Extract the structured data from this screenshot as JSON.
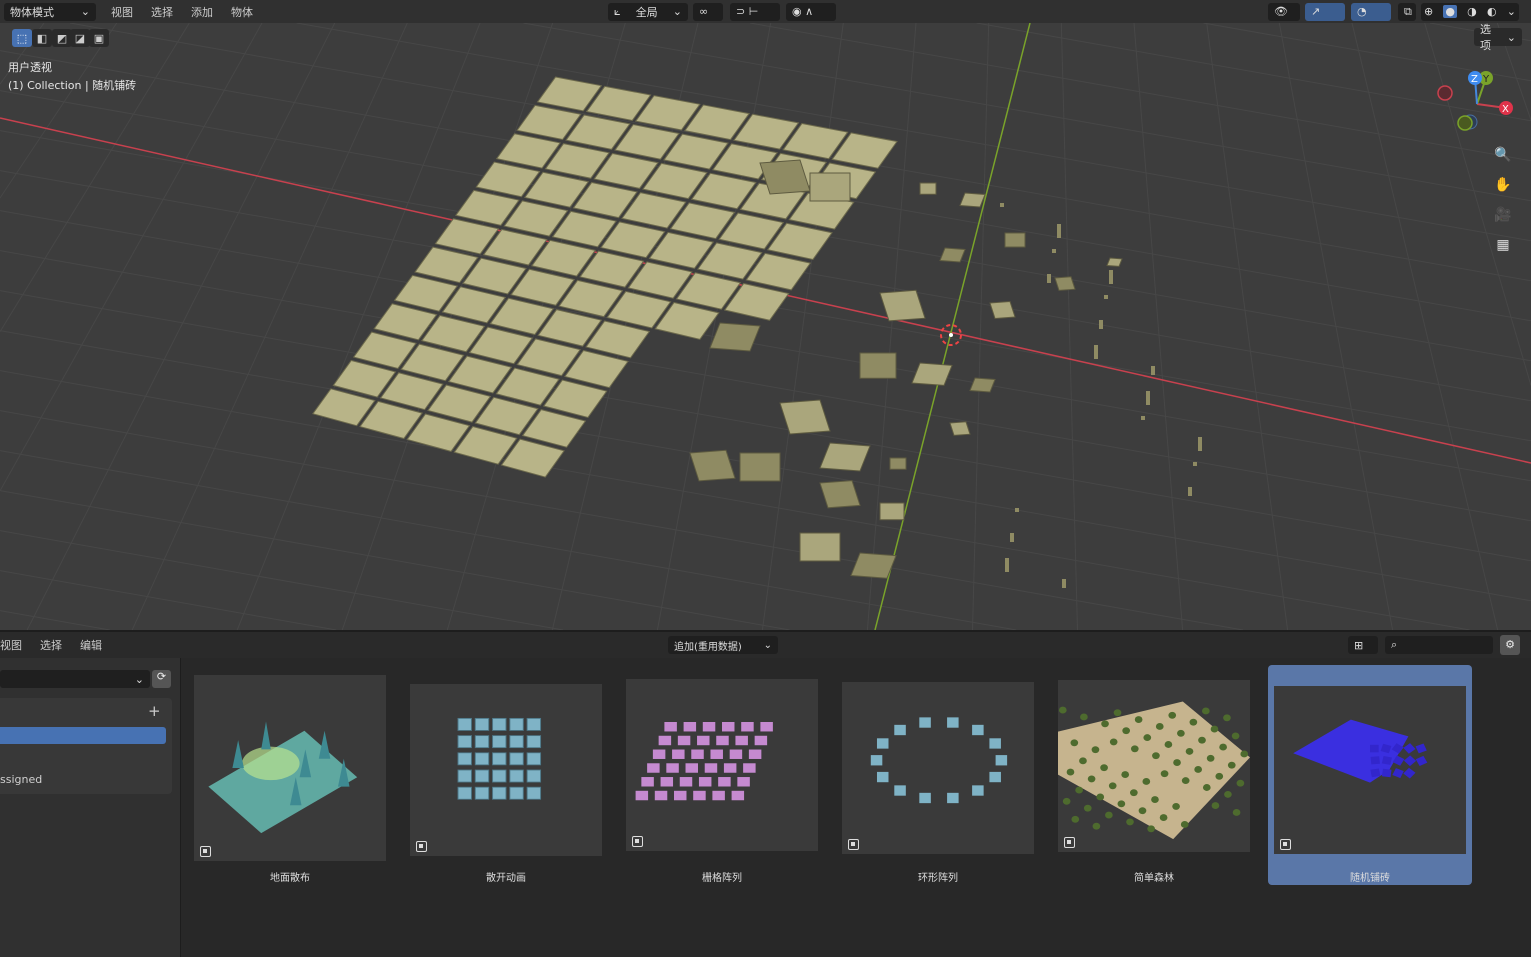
{
  "header": {
    "mode": "物体模式",
    "menus": [
      "视图",
      "选择",
      "添加",
      "物体"
    ],
    "transform_orientation": "全局"
  },
  "viewport": {
    "view_name": "用户透视",
    "collection_info": "(1) Collection | 随机铺砖",
    "options_label": "选项",
    "gizmo_axes": [
      "X",
      "Y",
      "Z"
    ]
  },
  "asset_browser": {
    "menus": [
      "视图",
      "选择",
      "编辑"
    ],
    "import_method": "追加(重用数据)",
    "search_placeholder": "",
    "left_items": [
      "",
      "",
      "ssigned"
    ],
    "assets": [
      {
        "label": "地面散布"
      },
      {
        "label": "散开动画"
      },
      {
        "label": "栅格阵列"
      },
      {
        "label": "环形阵列"
      },
      {
        "label": "简单森林"
      },
      {
        "label": "随机铺砖",
        "selected": true
      }
    ]
  },
  "colors": {
    "accent": "#4772b3",
    "tile": "#b8b488",
    "x_axis": "#c8414e",
    "y_axis": "#7aa32a",
    "selected_card": "#5a77a8"
  }
}
